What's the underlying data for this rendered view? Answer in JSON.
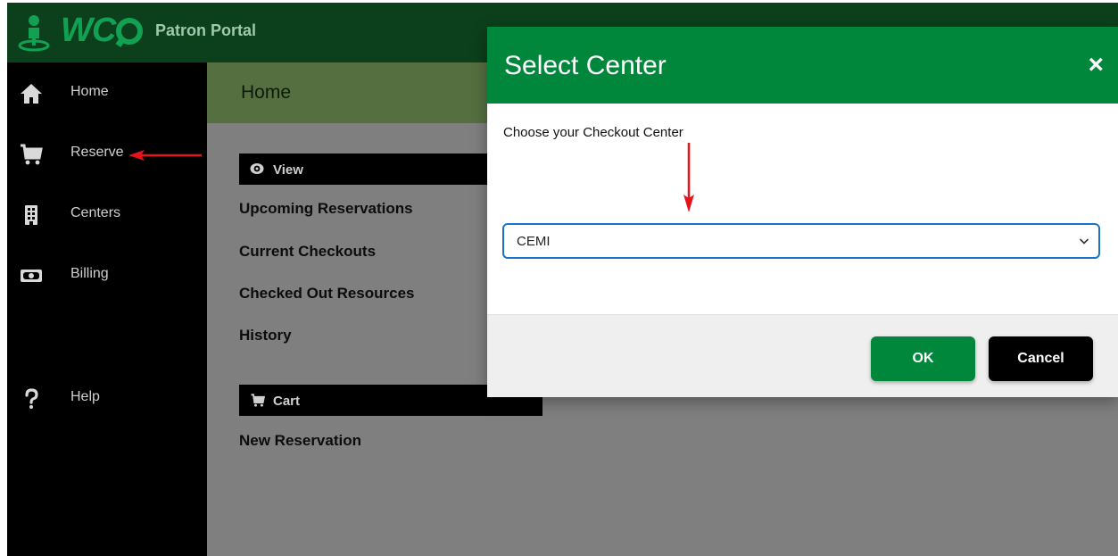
{
  "header": {
    "logo_text": "WC",
    "portal_title": "Patron Portal"
  },
  "sidebar": {
    "items": [
      {
        "label": "Home",
        "icon": "home-icon"
      },
      {
        "label": "Reserve",
        "icon": "cart-icon"
      },
      {
        "label": "Centers",
        "icon": "building-icon"
      },
      {
        "label": "Billing",
        "icon": "money-icon"
      },
      {
        "label": "Help",
        "icon": "question-icon"
      }
    ]
  },
  "content": {
    "title": "Home",
    "view_section": {
      "label": "View",
      "icon": "eye-icon"
    },
    "view_links": [
      "Upcoming Reservations",
      "Current Checkouts",
      "Checked Out Resources",
      "History"
    ],
    "cart_section": {
      "label": "Cart",
      "icon": "cart-icon"
    },
    "cart_links": [
      "New Reservation"
    ]
  },
  "modal": {
    "title": "Select Center",
    "close_label": "×",
    "prompt": "Choose your Checkout Center",
    "select_value": "CEMI",
    "ok_label": "OK",
    "cancel_label": "Cancel"
  },
  "colors": {
    "brand_green": "#00873c",
    "header_dark": "#0c3f1c",
    "focus_blue": "#1a73c8",
    "annotation_red": "#e3141b"
  }
}
